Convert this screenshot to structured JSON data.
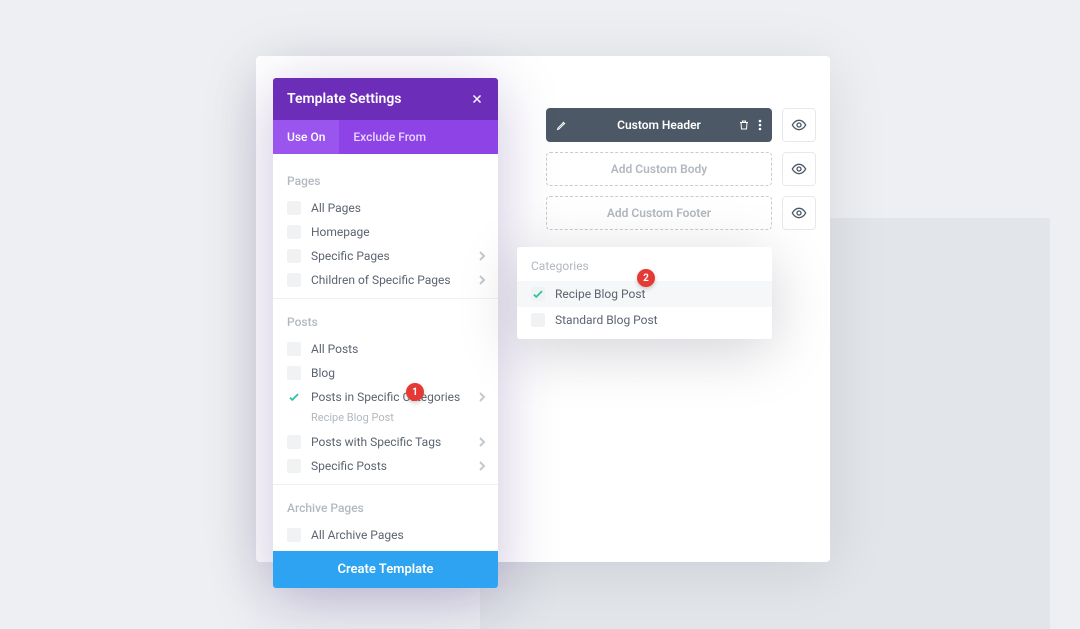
{
  "header": {
    "title": "Template Settings"
  },
  "tabs": {
    "useOn": "Use On",
    "excludeFrom": "Exclude From"
  },
  "sections": {
    "pages": {
      "label": "Pages",
      "items": [
        "All Pages",
        "Homepage",
        "Specific Pages",
        "Children of Specific Pages"
      ]
    },
    "posts": {
      "label": "Posts",
      "items": [
        "All Posts",
        "Blog",
        "Posts in Specific Categories",
        "Posts with Specific Tags",
        "Specific Posts"
      ],
      "subLabel": "Recipe Blog Post"
    },
    "archive": {
      "label": "Archive Pages",
      "items": [
        "All Archive Pages"
      ]
    }
  },
  "createButton": "Create Template",
  "flyout": {
    "label": "Categories",
    "items": [
      "Recipe Blog Post",
      "Standard Blog Post"
    ]
  },
  "rightSlots": {
    "header": "Custom Header",
    "body": "Add Custom Body",
    "footer": "Add Custom Footer"
  },
  "badges": {
    "one": "1",
    "two": "2"
  }
}
